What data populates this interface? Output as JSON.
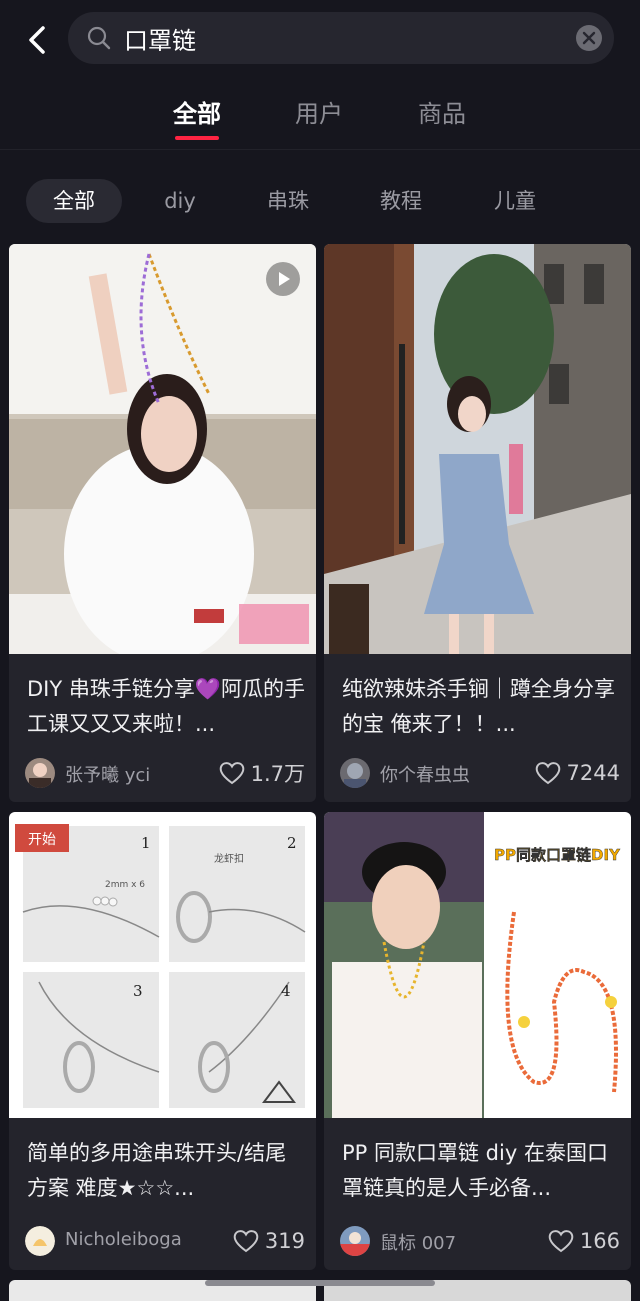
{
  "search": {
    "query": "口罩链"
  },
  "main_tabs": [
    {
      "label": "全部",
      "active": true
    },
    {
      "label": "用户",
      "active": false
    },
    {
      "label": "商品",
      "active": false
    }
  ],
  "filters": [
    {
      "label": "全部",
      "active": true
    },
    {
      "label": "diy",
      "active": false
    },
    {
      "label": "串珠",
      "active": false
    },
    {
      "label": "教程",
      "active": false
    },
    {
      "label": "儿童",
      "active": false
    }
  ],
  "posts": [
    {
      "title": "DIY 串珠手链分享💜阿瓜的手工课又又又来啦！...",
      "author": "张予曦 yci",
      "likes": "1.7万",
      "has_video": true
    },
    {
      "title": "纯欲辣妹杀手锏｜蹲全身分享的宝 俺来了！！...",
      "author": "你个春虫虫",
      "likes": "7244",
      "has_video": false
    },
    {
      "title": "简单的多用途串珠开头/结尾方案 难度★☆☆...",
      "author": "Nicholeiboga",
      "likes": "319",
      "has_video": false,
      "image_text": {
        "badge": "开始",
        "steps": [
          "1",
          "2",
          "3",
          "4"
        ],
        "note_1": "2mm x 6",
        "note_2": "龙虾扣"
      }
    },
    {
      "title": "PP 同款口罩链 diy 在泰国口罩链真的是人手必备...",
      "author": "鼠标 007",
      "likes": "166",
      "has_video": false,
      "image_text": {
        "banner": "PP同款口罩链DIY"
      }
    }
  ],
  "colors": {
    "accent": "#ff2442",
    "background": "#16161e",
    "card": "#24242c"
  }
}
